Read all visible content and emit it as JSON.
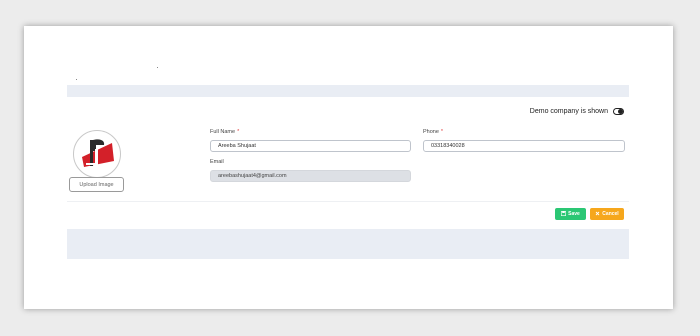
{
  "header": {
    "demo_label": "Demo company is shown"
  },
  "profile": {
    "upload_label": "Upload Image"
  },
  "form": {
    "full_name_label": "Full Name",
    "full_name_value": "Areeba Shujaat",
    "phone_label": "Phone",
    "phone_value": "03318340028",
    "email_label": "Email",
    "email_value": "areebashujaat4@gmail.com",
    "required_marker": "*"
  },
  "actions": {
    "save_label": "Save",
    "cancel_label": "Cancel",
    "save_icon": "floppy-disk-icon",
    "cancel_icon": "times-icon"
  },
  "colors": {
    "save": "#2bc774",
    "cancel": "#f6a71c",
    "required": "#e03a3a",
    "band": "#e9edf4"
  }
}
